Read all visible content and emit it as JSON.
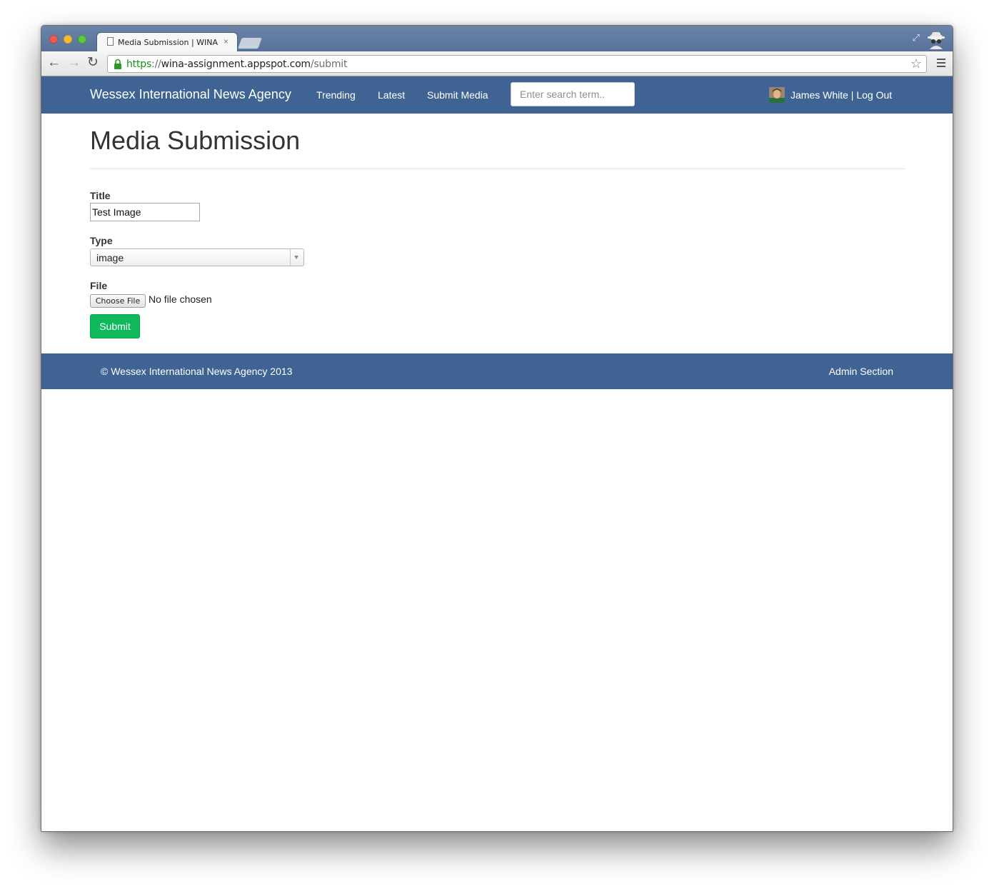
{
  "browser": {
    "tab_title": "Media Submission | WINA",
    "url_scheme": "https",
    "url_separator": "://",
    "url_host": "wina-assignment.appspot.com",
    "url_path": "/submit"
  },
  "navbar": {
    "brand": "Wessex International News Agency",
    "links": [
      "Trending",
      "Latest",
      "Submit Media"
    ],
    "search_placeholder": "Enter search term..",
    "user": "James White | Log Out"
  },
  "main": {
    "heading": "Media Submission",
    "title_label": "Title",
    "title_value": "Test Image",
    "type_label": "Type",
    "type_value": "image",
    "file_label": "File",
    "choose_file_label": "Choose File",
    "no_file_text": "No file chosen",
    "submit_label": "Submit"
  },
  "footer": {
    "copyright": "© Wessex International News Agency 2013",
    "admin_link": "Admin Section"
  },
  "colors": {
    "navbar_bg": "#3f6494",
    "submit_bg": "#0fb85a",
    "url_scheme": "#1a8e16"
  },
  "icons": [
    "back-icon",
    "forward-icon",
    "reload-icon",
    "lock-icon",
    "star-icon",
    "menu-icon",
    "incognito-icon",
    "document-icon",
    "restore-icon",
    "chevron-down-icon"
  ]
}
